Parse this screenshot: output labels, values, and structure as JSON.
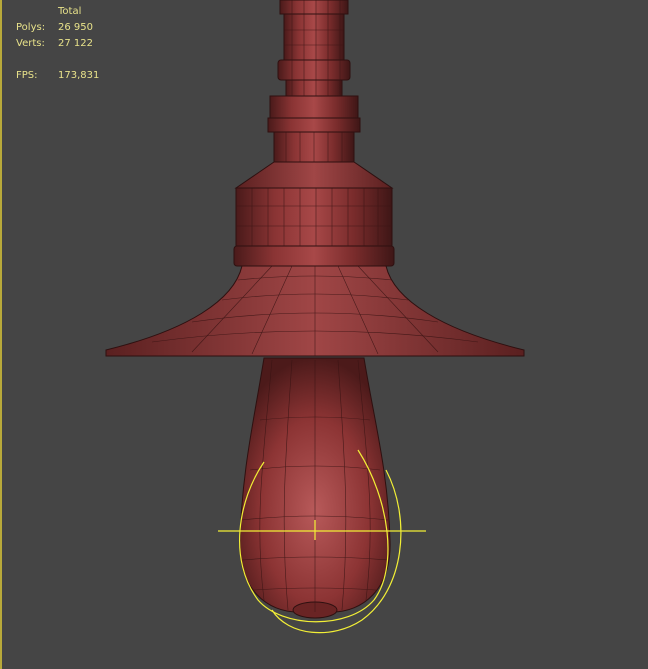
{
  "viewport": {
    "name": "perspective-viewport",
    "background_color": "#454545",
    "border_color": "#b8a93a"
  },
  "statistics": {
    "header": "Total",
    "polys_label": "Polys:",
    "polys_value": "26 950",
    "verts_label": "Verts:",
    "verts_value": "27 122",
    "fps_label": "FPS:",
    "fps_value": "173,831",
    "text_color": "#e8e28a"
  },
  "model": {
    "description_icon": "pendant-lamp-wireframe",
    "surface_color": "#8c3636",
    "wire_color": "#3a1414",
    "selection_gizmo_color": "#f2ef36"
  }
}
